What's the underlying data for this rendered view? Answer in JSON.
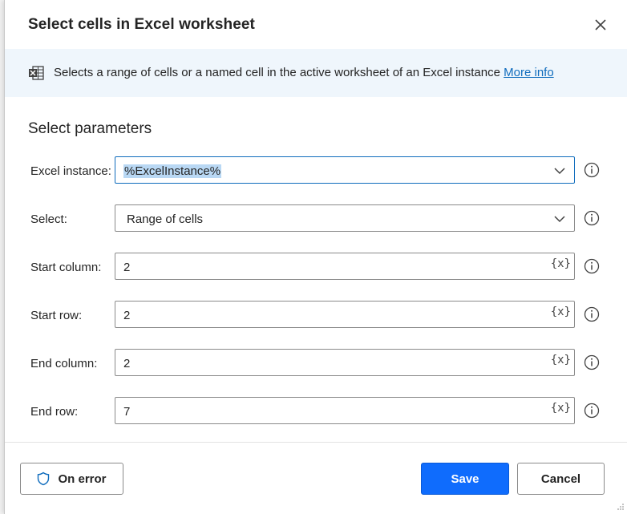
{
  "dialog": {
    "title": "Select cells in Excel worksheet",
    "description": "Selects a range of cells or a named cell in the active worksheet of an Excel instance ",
    "more_info": "More info",
    "section_title": "Select parameters"
  },
  "fields": [
    {
      "label": "Excel instance:",
      "value": "%ExcelInstance%",
      "kind": "dropdown"
    },
    {
      "label": "Select:",
      "value": "Range of cells",
      "kind": "dropdown"
    },
    {
      "label": "Start column:",
      "value": "2",
      "kind": "text"
    },
    {
      "label": "Start row:",
      "value": "2",
      "kind": "text"
    },
    {
      "label": "End column:",
      "value": "2",
      "kind": "text"
    },
    {
      "label": "End row:",
      "value": "7",
      "kind": "text"
    }
  ],
  "variable_button": "{x}",
  "footer": {
    "on_error": "On error",
    "save": "Save",
    "cancel": "Cancel"
  },
  "colors": {
    "accent": "#0f6cfd",
    "link": "#0f6cbd",
    "banner": "#eff6fc"
  }
}
